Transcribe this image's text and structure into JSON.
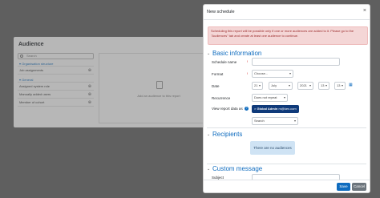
{
  "audience_panel": {
    "title": "Audience",
    "search_placeholder": "Search",
    "groups": [
      {
        "label": "Organisation structure",
        "items": [
          {
            "label": "Job assignments"
          }
        ]
      },
      {
        "label": "General",
        "items": [
          {
            "label": "Assigned system role"
          },
          {
            "label": "Manually added users"
          },
          {
            "label": "Member of cohort"
          }
        ]
      }
    ],
    "right_hint": "Add an audience to this report"
  },
  "modal": {
    "title": "New schedule",
    "close_icon": "close-icon",
    "alert": "Scheduling this report will be possible only if one or more audiences are added to it. Please go to the \"Audiences\" tab and create at least one audience to continue.",
    "sections": {
      "basic": "Basic information",
      "recipients": "Recipients",
      "custom_message": "Custom message"
    },
    "fields": {
      "schedule_name_label": "Schedule name",
      "format_label": "Format",
      "format_value": "Choose...",
      "date_label": "Date",
      "date_day": "21",
      "date_month": "July",
      "date_year": "2021",
      "date_hour": "13",
      "date_minute": "13",
      "recurrence_label": "Recurrence",
      "recurrence_value": "Does not repeat",
      "view_as_label": "View report data as",
      "view_as_user_name": "Global Admin",
      "view_as_user_email": "m@kex.com",
      "search_placeholder": "Search",
      "no_audiences": "There are no audiences",
      "subject_label": "Subject"
    },
    "buttons": {
      "save": "Save",
      "cancel": "Cancel"
    }
  }
}
